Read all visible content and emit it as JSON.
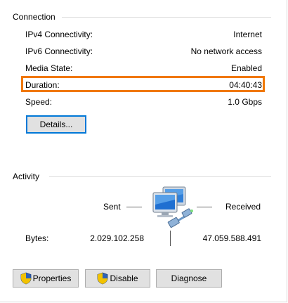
{
  "connection": {
    "title": "Connection",
    "rows": [
      {
        "label": "IPv4 Connectivity:",
        "value": "Internet"
      },
      {
        "label": "IPv6 Connectivity:",
        "value": "No network access"
      },
      {
        "label": "Media State:",
        "value": "Enabled"
      },
      {
        "label": "Duration:",
        "value": "04:40:43"
      },
      {
        "label": "Speed:",
        "value": "1.0 Gbps"
      }
    ],
    "details_label": "Details..."
  },
  "activity": {
    "title": "Activity",
    "sent_label": "Sent",
    "received_label": "Received",
    "bytes_label": "Bytes:",
    "bytes_sent": "2.029.102.258",
    "bytes_received": "47.059.588.491"
  },
  "buttons": {
    "properties": "Properties",
    "disable": "Disable",
    "diagnose": "Diagnose"
  },
  "colors": {
    "highlight": "#f07800",
    "button_face": "#e1e1e1",
    "focus_border": "#0078d7"
  }
}
